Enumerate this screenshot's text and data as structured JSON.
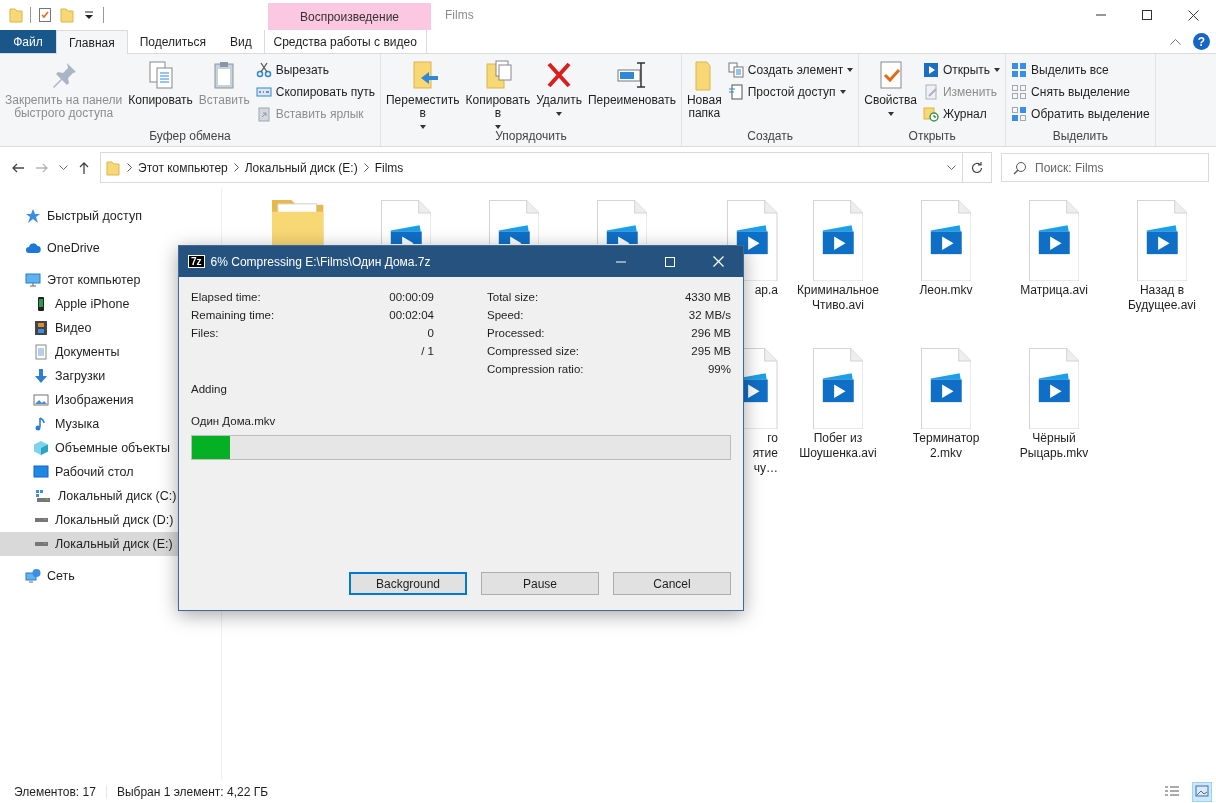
{
  "window": {
    "title": "Films",
    "context_group": "Воспроизведение",
    "help": "?"
  },
  "tabs": [
    {
      "label": "Файл",
      "selected": false,
      "kind": "file"
    },
    {
      "label": "Главная",
      "selected": true,
      "kind": "tab"
    },
    {
      "label": "Поделиться",
      "selected": false,
      "kind": "tab"
    },
    {
      "label": "Вид",
      "selected": false,
      "kind": "tab"
    },
    {
      "label": "Средства работы с видео",
      "selected": false,
      "kind": "context"
    }
  ],
  "ribbon_groups": [
    {
      "name": "Буфер обмена",
      "items": [
        {
          "label": "Закрепить на панели\nбыстрого доступа",
          "kind": "large",
          "disabled": true,
          "dropdown": false
        },
        {
          "label": "Копировать",
          "kind": "large",
          "disabled": false,
          "dropdown": false
        },
        {
          "label": "Вставить",
          "kind": "large",
          "disabled": true,
          "dropdown": false
        },
        {
          "label": "Вырезать",
          "kind": "small",
          "disabled": false,
          "dropdown": false
        },
        {
          "label": "Скопировать путь",
          "kind": "small",
          "disabled": false,
          "dropdown": false
        },
        {
          "label": "Вставить ярлык",
          "kind": "small",
          "disabled": true,
          "dropdown": false
        }
      ]
    },
    {
      "name": "Упорядочить",
      "items": [
        {
          "label": "Переместить\nв",
          "kind": "large",
          "disabled": false,
          "dropdown": true
        },
        {
          "label": "Копировать\nв",
          "kind": "large",
          "disabled": false,
          "dropdown": true
        },
        {
          "label": "Удалить",
          "kind": "large",
          "disabled": false,
          "dropdown": true
        },
        {
          "label": "Переименовать",
          "kind": "large",
          "disabled": false,
          "dropdown": false
        }
      ]
    },
    {
      "name": "Создать",
      "items": [
        {
          "label": "Новая\nпапка",
          "kind": "large",
          "disabled": false,
          "dropdown": false
        },
        {
          "label": "Создать элемент",
          "kind": "small",
          "disabled": false,
          "dropdown": true
        },
        {
          "label": "Простой доступ",
          "kind": "small",
          "disabled": false,
          "dropdown": true
        }
      ]
    },
    {
      "name": "Открыть",
      "items": [
        {
          "label": "Свойства",
          "kind": "large",
          "disabled": false,
          "dropdown": true
        },
        {
          "label": "Открыть",
          "kind": "small",
          "disabled": false,
          "dropdown": true
        },
        {
          "label": "Изменить",
          "kind": "small",
          "disabled": true,
          "dropdown": false
        },
        {
          "label": "Журнал",
          "kind": "small",
          "disabled": false,
          "dropdown": false
        }
      ]
    },
    {
      "name": "Выделить",
      "items": [
        {
          "label": "Выделить все",
          "kind": "small",
          "disabled": false,
          "dropdown": false
        },
        {
          "label": "Снять выделение",
          "kind": "small",
          "disabled": false,
          "dropdown": false
        },
        {
          "label": "Обратить выделение",
          "kind": "small",
          "disabled": false,
          "dropdown": false
        }
      ]
    }
  ],
  "address_bar": {
    "breadcrumbs": [
      "Этот компьютер",
      "Локальный диск (E:)",
      "Films"
    ]
  },
  "search": {
    "placeholder": "Поиск: Films"
  },
  "sidebar": [
    {
      "label": "Быстрый доступ",
      "selected": false
    },
    {
      "label": "OneDrive",
      "selected": false
    },
    {
      "label": "Этот компьютер",
      "selected": false,
      "children": [
        {
          "label": "Apple iPhone",
          "selected": false
        },
        {
          "label": "Видео",
          "selected": false
        },
        {
          "label": "Документы",
          "selected": false
        },
        {
          "label": "Загрузки",
          "selected": false
        },
        {
          "label": "Изображения",
          "selected": false
        },
        {
          "label": "Музыка",
          "selected": false
        },
        {
          "label": "Объемные объекты",
          "selected": false
        },
        {
          "label": "Рабочий стол",
          "selected": false
        },
        {
          "label": "Локальный диск (C:)",
          "selected": false
        },
        {
          "label": "Локальный диск (D:)",
          "selected": false
        },
        {
          "label": "Локальный диск (E:)",
          "selected": true
        }
      ]
    },
    {
      "label": "Сеть",
      "selected": false
    }
  ],
  "files": [
    [
      {
        "kind": "folder"
      },
      {
        "kind": "video"
      },
      {
        "kind": "video"
      },
      {
        "kind": "video"
      },
      {
        "kind": "video",
        "label_lines": [
          "ар.а"
        ],
        "covered": true
      },
      {
        "kind": "video",
        "label_lines": [
          "Криминальное",
          "Чтиво.avi"
        ]
      },
      {
        "kind": "video",
        "label_lines": [
          "Леон.mkv"
        ]
      },
      {
        "kind": "video",
        "label_lines": [
          "Матрица.avi"
        ]
      },
      {
        "kind": "video",
        "label_lines": [
          "Назад в",
          "Будущее.avi"
        ]
      }
    ],
    [
      {
        "kind": "video",
        "label_lines": [
          "го",
          "ятие",
          "чу…"
        ],
        "covered": true
      },
      {
        "kind": "video",
        "label_lines": [
          "Побег из",
          "Шоушенка.avi"
        ]
      },
      {
        "kind": "video",
        "label_lines": [
          "Терминатор",
          "2.mkv"
        ]
      },
      {
        "kind": "video",
        "label_lines": [
          "Чёрный",
          "Рыцарь.mkv"
        ]
      }
    ]
  ],
  "status_bar": {
    "count": "Элементов: 17",
    "selection": "Выбран 1 элемент: 4,22 ГБ",
    "views": [
      {
        "selected": false
      },
      {
        "selected": true
      }
    ]
  },
  "dialog": {
    "logo": "7z",
    "title": "6% Compressing E:\\Films\\Один Дома.7z",
    "stats_left": [
      {
        "label": "Elapsed time:",
        "value": "00:00:09"
      },
      {
        "label": "Remaining time:",
        "value": "00:02:04"
      },
      {
        "label": "Files:",
        "value": "0"
      },
      {
        "value": "/ 1"
      }
    ],
    "stats_right": [
      {
        "label": "Total size:",
        "value": "4330 MB"
      },
      {
        "label": "Speed:",
        "value": "32 MB/s"
      },
      {
        "label": "Processed:",
        "value": "296 MB"
      },
      {
        "label": "Compressed size:",
        "value": "295 MB"
      },
      {
        "label": "Compression ratio:",
        "value": "99%"
      }
    ],
    "status": "Adding",
    "current_file": "Один Дома.mkv",
    "progress": {
      "level": 0.07
    },
    "buttons": [
      {
        "label": "Background",
        "focused": true
      },
      {
        "label": "Pause",
        "focused": false
      },
      {
        "label": "Cancel",
        "focused": false
      }
    ]
  }
}
